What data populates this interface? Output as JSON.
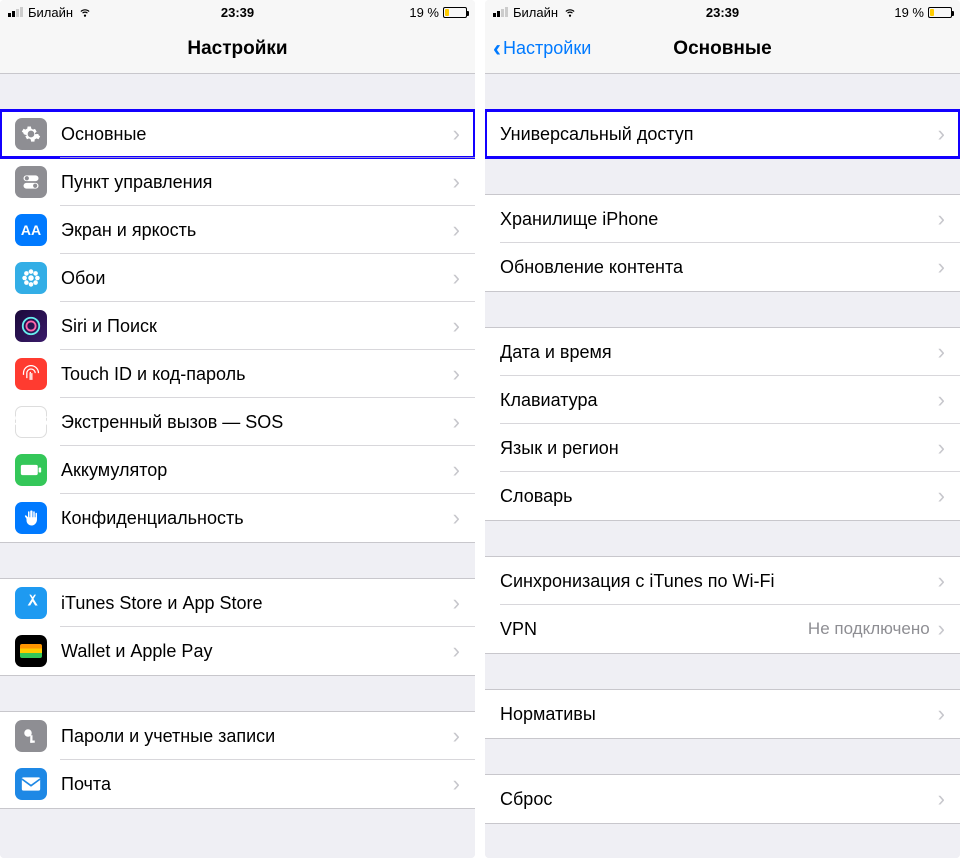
{
  "status": {
    "carrier": "Билайн",
    "time": "23:39",
    "battery_text": "19 %"
  },
  "left": {
    "title": "Настройки",
    "groups": [
      {
        "spacer": true,
        "rows": [
          {
            "id": "general",
            "icon": "gear",
            "icon_bg": "bg-gear",
            "label": "Основные",
            "highlight": true
          },
          {
            "id": "control-center",
            "icon": "toggles",
            "icon_bg": "bg-control",
            "label": "Пункт управления"
          },
          {
            "id": "display",
            "icon": "AA",
            "icon_bg": "bg-display",
            "label": "Экран и яркость"
          },
          {
            "id": "wallpaper",
            "icon": "flower",
            "icon_bg": "bg-wallpaper",
            "label": "Обои"
          },
          {
            "id": "siri",
            "icon": "siri",
            "icon_bg": "bg-siri",
            "label": "Siri и Поиск"
          },
          {
            "id": "touchid",
            "icon": "fingerprint",
            "icon_bg": "bg-touchid",
            "label": "Touch ID и код-пароль"
          },
          {
            "id": "sos",
            "icon": "SOS",
            "icon_bg": "bg-sos",
            "label": "Экстренный вызов — SOS"
          },
          {
            "id": "battery",
            "icon": "battery",
            "icon_bg": "bg-battery",
            "label": "Аккумулятор"
          },
          {
            "id": "privacy",
            "icon": "hand",
            "icon_bg": "bg-privacy",
            "label": "Конфиденциальность"
          }
        ]
      },
      {
        "spacer": true,
        "rows": [
          {
            "id": "appstore",
            "icon": "appstore",
            "icon_bg": "bg-appstore",
            "label": "iTunes Store и App Store"
          },
          {
            "id": "wallet",
            "icon": "wallet",
            "icon_bg": "bg-wallet",
            "label": "Wallet и Apple Pay"
          }
        ]
      },
      {
        "spacer": true,
        "rows": [
          {
            "id": "passwords",
            "icon": "key",
            "icon_bg": "bg-passwords",
            "label": "Пароли и учетные записи"
          },
          {
            "id": "mail",
            "icon": "mail",
            "icon_bg": "bg-mail",
            "label": "Почта"
          }
        ]
      }
    ]
  },
  "right": {
    "back_label": "Настройки",
    "title": "Основные",
    "groups": [
      {
        "spacer": true,
        "rows": [
          {
            "id": "accessibility",
            "label": "Универсальный доступ",
            "highlight": true
          }
        ]
      },
      {
        "spacer": true,
        "rows": [
          {
            "id": "storage",
            "label": "Хранилище iPhone"
          },
          {
            "id": "background-refresh",
            "label": "Обновление контента"
          }
        ]
      },
      {
        "spacer": true,
        "rows": [
          {
            "id": "date-time",
            "label": "Дата и время"
          },
          {
            "id": "keyboard",
            "label": "Клавиатура"
          },
          {
            "id": "language",
            "label": "Язык и регион"
          },
          {
            "id": "dictionary",
            "label": "Словарь"
          }
        ]
      },
      {
        "spacer": true,
        "rows": [
          {
            "id": "itunes-wifi",
            "label": "Синхронизация с iTunes по Wi-Fi"
          },
          {
            "id": "vpn",
            "label": "VPN",
            "value": "Не подключено"
          }
        ]
      },
      {
        "spacer": true,
        "rows": [
          {
            "id": "regulatory",
            "label": "Нормативы"
          }
        ]
      },
      {
        "spacer": true,
        "rows": [
          {
            "id": "reset",
            "label": "Сброс"
          }
        ]
      }
    ]
  }
}
